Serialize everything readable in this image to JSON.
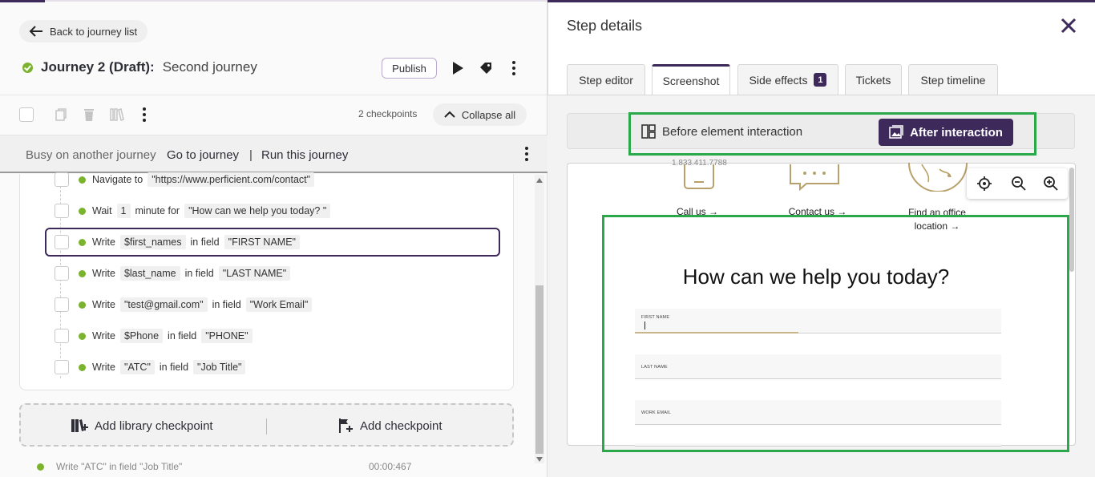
{
  "left": {
    "back_label": "Back to journey list",
    "journey_title_strong": "Journey 2 (Draft):",
    "journey_title_rest": "Second journey",
    "publish_label": "Publish",
    "checkpoint_count": "2 checkpoints",
    "collapse_label": "Collapse all",
    "busy_text": "Busy on another journey",
    "goto_label": "Go to journey",
    "pipe": "|",
    "run_label": "Run this journey",
    "steps": [
      {
        "verb": "Navigate to",
        "a": "\"https://www.perficient.com/contact\"",
        "mid": "",
        "b": ""
      },
      {
        "verb": "Wait",
        "a": "1",
        "mid": "minute for",
        "b": "\"How can we help you today? \""
      },
      {
        "verb": "Write",
        "a": "$first_names",
        "mid": "in field",
        "b": "\"FIRST NAME\""
      },
      {
        "verb": "Write",
        "a": "$last_name",
        "mid": "in field",
        "b": "\"LAST NAME\""
      },
      {
        "verb": "Write",
        "a": "\"test@gmail.com\"",
        "mid": "in field",
        "b": "\"Work Email\""
      },
      {
        "verb": "Write",
        "a": "$Phone",
        "mid": "in field",
        "b": "\"PHONE\""
      },
      {
        "verb": "Write",
        "a": "\"ATC\"",
        "mid": "in field",
        "b": "\"Job Title\""
      }
    ],
    "add_library_label": "Add library checkpoint",
    "add_checkpoint_label": "Add checkpoint",
    "ghost_row": {
      "text": "Write  \"ATC\"  in field  \"Job Title\"",
      "time": "00:00:467"
    }
  },
  "right": {
    "title": "Step details",
    "tabs": [
      {
        "label": "Step editor"
      },
      {
        "label": "Screenshot"
      },
      {
        "label": "Side effects",
        "badge": "1"
      },
      {
        "label": "Tickets"
      },
      {
        "label": "Step timeline"
      }
    ],
    "before_label": "Before element interaction",
    "after_label": "After interaction",
    "screenshot": {
      "phone": "1.833.411.7788",
      "call_us": "Call us →",
      "contact_us": "Contact us →",
      "find_office": "Find an office location →",
      "heading": "How can we help you today?",
      "fields": [
        "FIRST NAME",
        "LAST NAME",
        "WORK EMAIL"
      ]
    }
  },
  "colors": {
    "accent": "#3d2a5a",
    "success": "#7bb32e",
    "highlight": "#2aa84a"
  }
}
